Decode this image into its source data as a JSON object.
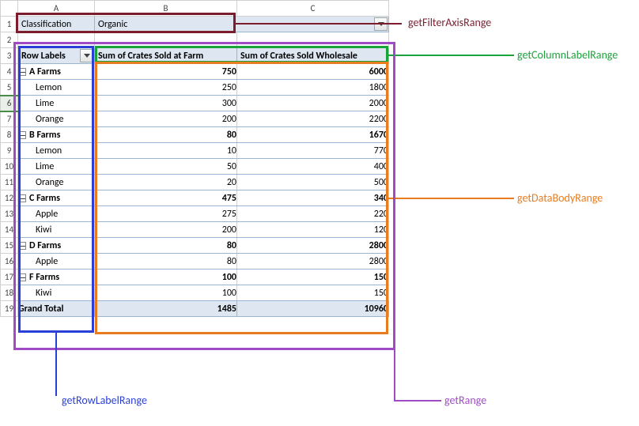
{
  "columns": [
    "A",
    "B",
    "C"
  ],
  "filter": {
    "label": "Classification",
    "value": "Organic"
  },
  "header": {
    "rowLabels": "Row Labels",
    "col1": "Sum of Crates Sold at Farm",
    "col2": "Sum of Crates Sold Wholesale"
  },
  "rows": [
    {
      "type": "group",
      "label": "A Farms",
      "v1": "750",
      "v2": "6000"
    },
    {
      "type": "item",
      "label": "Lemon",
      "v1": "250",
      "v2": "1800"
    },
    {
      "type": "item",
      "label": "Lime",
      "v1": "300",
      "v2": "2000"
    },
    {
      "type": "item",
      "label": "Orange",
      "v1": "200",
      "v2": "2200"
    },
    {
      "type": "group",
      "label": "B Farms",
      "v1": "80",
      "v2": "1670"
    },
    {
      "type": "item",
      "label": "Lemon",
      "v1": "10",
      "v2": "770"
    },
    {
      "type": "item",
      "label": "Lime",
      "v1": "50",
      "v2": "400"
    },
    {
      "type": "item",
      "label": "Orange",
      "v1": "20",
      "v2": "500"
    },
    {
      "type": "group",
      "label": "C Farms",
      "v1": "475",
      "v2": "340"
    },
    {
      "type": "item",
      "label": "Apple",
      "v1": "275",
      "v2": "220"
    },
    {
      "type": "item",
      "label": "Kiwi",
      "v1": "200",
      "v2": "120"
    },
    {
      "type": "group",
      "label": "D Farms",
      "v1": "80",
      "v2": "2800"
    },
    {
      "type": "item",
      "label": "Apple",
      "v1": "80",
      "v2": "2800"
    },
    {
      "type": "group",
      "label": "F Farms",
      "v1": "100",
      "v2": "150"
    },
    {
      "type": "item",
      "label": "Kiwi",
      "v1": "100",
      "v2": "150"
    }
  ],
  "grand": {
    "label": "Grand Total",
    "v1": "1485",
    "v2": "10960"
  },
  "annotations": {
    "filterAxis": "getFilterAxisRange",
    "columnLabel": "getColumnLabelRange",
    "dataBody": "getDataBodyRange",
    "range": "getRange",
    "rowLabel": "getRowLabelRange"
  },
  "chart_data": {
    "type": "table",
    "title": "PivotTable: Sum of Crates Sold (filtered by Classification = Organic)",
    "columns": [
      "Row Labels",
      "Sum of Crates Sold at Farm",
      "Sum of Crates Sold Wholesale"
    ],
    "rows": [
      [
        "A Farms",
        750,
        6000
      ],
      [
        "  Lemon",
        250,
        1800
      ],
      [
        "  Lime",
        300,
        2000
      ],
      [
        "  Orange",
        200,
        2200
      ],
      [
        "B Farms",
        80,
        1670
      ],
      [
        "  Lemon",
        10,
        770
      ],
      [
        "  Lime",
        50,
        400
      ],
      [
        "  Orange",
        20,
        500
      ],
      [
        "C Farms",
        475,
        340
      ],
      [
        "  Apple",
        275,
        220
      ],
      [
        "  Kiwi",
        200,
        120
      ],
      [
        "D Farms",
        80,
        2800
      ],
      [
        "  Apple",
        80,
        2800
      ],
      [
        "F Farms",
        100,
        150
      ],
      [
        "  Kiwi",
        100,
        150
      ],
      [
        "Grand Total",
        1485,
        10960
      ]
    ]
  }
}
